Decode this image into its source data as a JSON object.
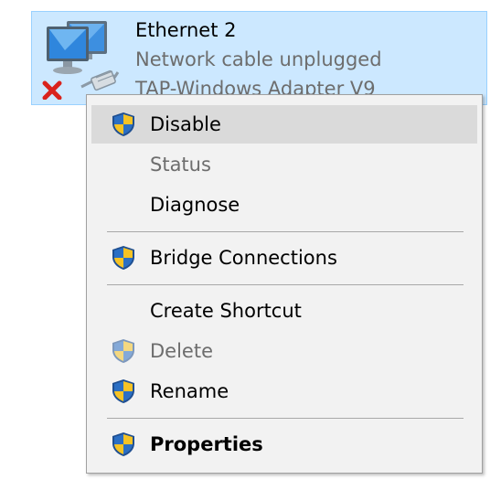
{
  "adapter": {
    "name": "Ethernet 2",
    "status": "Network cable unplugged",
    "device": "TAP-Windows Adapter V9",
    "icon": "network-adapter-disconnected-icon"
  },
  "colors": {
    "selection_fill": "#cce8ff",
    "selection_border": "#99d1ff",
    "menu_background": "#f2f2f2",
    "menu_highlight": "#dadada",
    "disabled_text": "#6d6d6d",
    "shield_blue": "#2b6fc4",
    "shield_yellow": "#f6c324",
    "error_red": "#d9221c"
  },
  "context_menu": {
    "items": [
      {
        "label": "Disable",
        "icon": "uac-shield-icon",
        "enabled": true,
        "highlighted": true
      },
      {
        "label": "Status",
        "icon": null,
        "enabled": false
      },
      {
        "label": "Diagnose",
        "icon": null,
        "enabled": true
      },
      {
        "label": "Bridge Connections",
        "icon": "uac-shield-icon",
        "enabled": true
      },
      {
        "label": "Create Shortcut",
        "icon": null,
        "enabled": true
      },
      {
        "label": "Delete",
        "icon": "uac-shield-icon",
        "enabled": false
      },
      {
        "label": "Rename",
        "icon": "uac-shield-icon",
        "enabled": true
      },
      {
        "label": "Properties",
        "icon": "uac-shield-icon",
        "enabled": true,
        "default": true
      }
    ]
  }
}
